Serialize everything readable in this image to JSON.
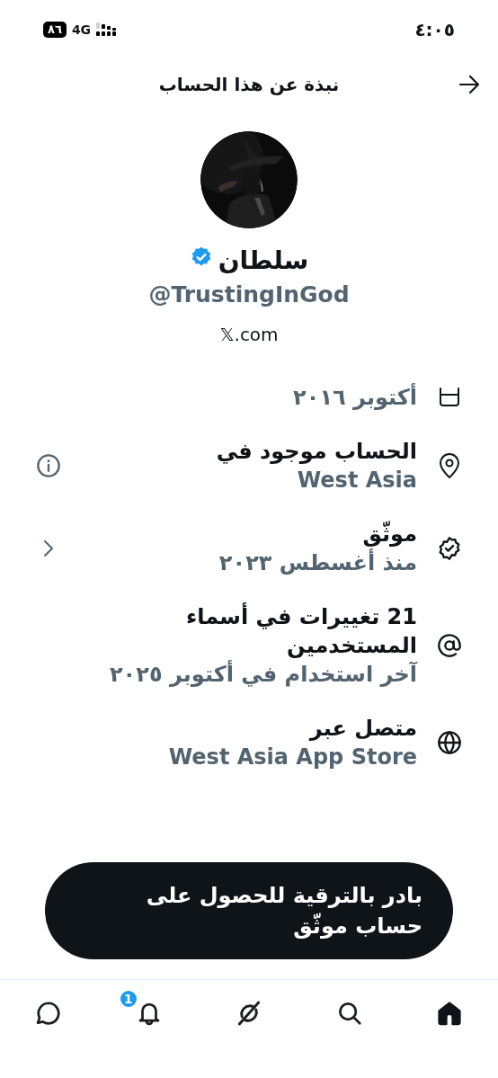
{
  "status_bar": {
    "time": "٤:٠٥",
    "network": "4G",
    "battery": "٨٦"
  },
  "header": {
    "title": "نبذة عن هذا الحساب"
  },
  "profile": {
    "name": "سلطان",
    "verified": true,
    "handle": "@TrustingInGod",
    "site": "𝕏.com"
  },
  "rows": [
    {
      "kind": "joined",
      "subtitle": "أكتوبر ٢٠١٦"
    },
    {
      "kind": "location",
      "title": "الحساب موجود في",
      "subtitle": "West Asia"
    },
    {
      "kind": "verified",
      "title": "موثّق",
      "subtitle": "منذ أغسطس ٢٠٢٣"
    },
    {
      "kind": "usernames",
      "title": "21 تغييرات في أسماء المستخدمين",
      "subtitle": "آخر استخدام في أكتوبر ٢٠٢٥"
    },
    {
      "kind": "connected",
      "title": "متصل عبر",
      "subtitle": "West Asia App Store"
    }
  ],
  "cta": {
    "label": "بادر بالترقية للحصول على حساب موثّق"
  },
  "tab_bar": [
    {
      "kind": "messages",
      "selected": false
    },
    {
      "kind": "notifications",
      "selected": false,
      "badge": "1"
    },
    {
      "kind": "grok",
      "selected": false
    },
    {
      "kind": "search",
      "selected": false
    },
    {
      "kind": "home",
      "selected": true
    }
  ]
}
